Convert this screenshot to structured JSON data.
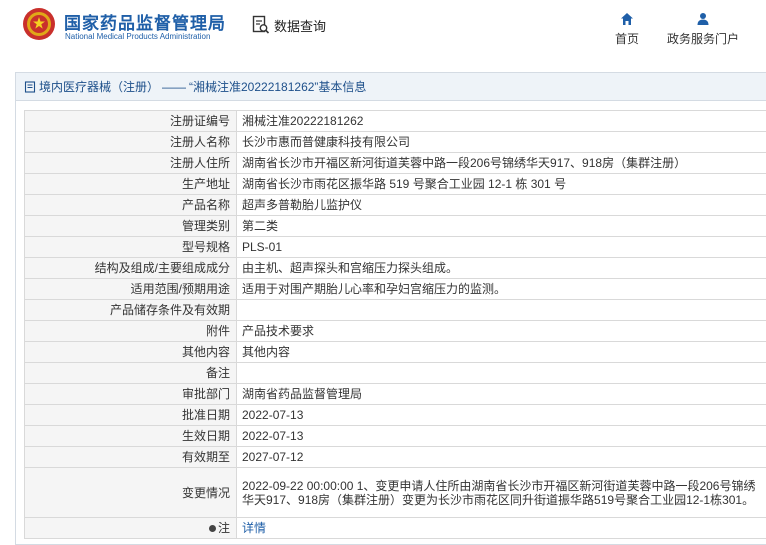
{
  "header": {
    "logo_cn": "国家药品监督管理局",
    "logo_en": "National Medical Products Administration",
    "query_label": "数据查询",
    "nav": {
      "home_label": "首页",
      "service_label": "政务服务门户"
    }
  },
  "breadcrumb": {
    "category": "境内医疗器械（注册）",
    "separator": "——",
    "title": "“湘械注准20222181262”基本信息"
  },
  "rows": [
    {
      "label": "注册证编号",
      "value": "湘械注准20222181262"
    },
    {
      "label": "注册人名称",
      "value": "长沙市惠而普健康科技有限公司"
    },
    {
      "label": "注册人住所",
      "value": "湖南省长沙市开福区新河街道芙蓉中路一段206号锦绣华天917、918房（集群注册）"
    },
    {
      "label": "生产地址",
      "value": "湖南省长沙市雨花区振华路 519 号聚合工业园 12-1 栋 301 号"
    },
    {
      "label": "产品名称",
      "value": "超声多普勒胎儿监护仪"
    },
    {
      "label": "管理类别",
      "value": "第二类"
    },
    {
      "label": "型号规格",
      "value": "PLS-01"
    },
    {
      "label": "结构及组成/主要组成成分",
      "value": "由主机、超声探头和宫缩压力探头组成。"
    },
    {
      "label": "适用范围/预期用途",
      "value": "适用于对围产期胎儿心率和孕妇宫缩压力的监测。"
    },
    {
      "label": "产品储存条件及有效期",
      "value": ""
    },
    {
      "label": "附件",
      "value": "产品技术要求"
    },
    {
      "label": "其他内容",
      "value": "其他内容"
    },
    {
      "label": "备注",
      "value": ""
    },
    {
      "label": "审批部门",
      "value": "湖南省药品监督管理局"
    },
    {
      "label": "批准日期",
      "value": "2022-07-13"
    },
    {
      "label": "生效日期",
      "value": "2022-07-13"
    },
    {
      "label": "有效期至",
      "value": "2027-07-12"
    },
    {
      "label": "变更情况",
      "value": "2022-09-22 00:00:00 1、变更申请人住所由湖南省长沙市开福区新河街道芙蓉中路一段206号锦绣华天917、918房（集群注册）变更为长沙市雨花区同升街道振华路519号聚合工业园12-1栋301。"
    }
  ],
  "note_row": {
    "label": "注",
    "link": "详情"
  },
  "colors": {
    "brand": "#1f5fa8",
    "label_bg": "#f5f5f5",
    "breadcrumb_bg": "#eef3f8",
    "border": "#d9d9d9"
  },
  "icons": [
    "national-emblem-icon",
    "data-query-icon",
    "home-icon",
    "user-icon",
    "document-icon",
    "note-bullet-icon"
  ]
}
